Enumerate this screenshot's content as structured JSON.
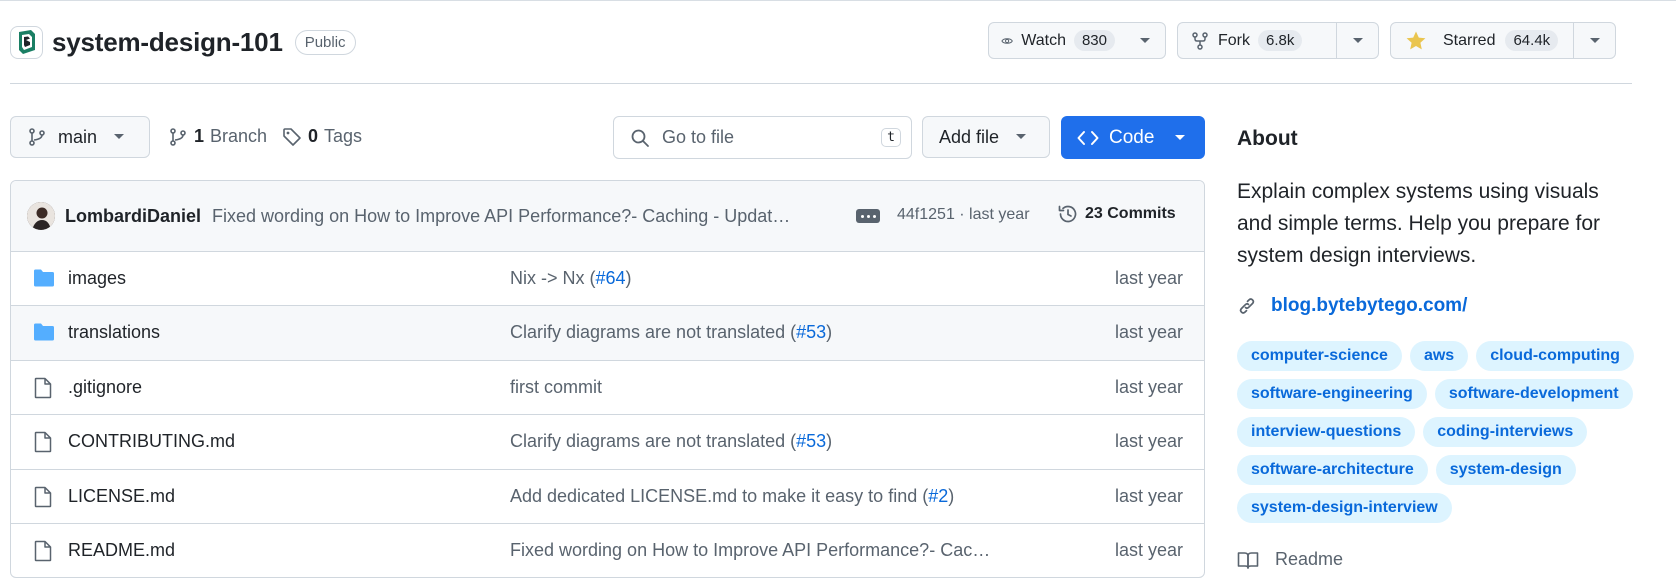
{
  "repo": {
    "name": "system-design-101",
    "visibility": "Public"
  },
  "header_actions": {
    "watch": {
      "label": "Watch",
      "count": "830"
    },
    "fork": {
      "label": "Fork",
      "count": "6.8k"
    },
    "star": {
      "label": "Starred",
      "count": "64.4k"
    }
  },
  "toolbar": {
    "branch": "main",
    "branches_count": "1",
    "branches_label": "Branch",
    "tags_count": "0",
    "tags_label": "Tags",
    "search_placeholder": "Go to file",
    "search_shortcut": "t",
    "add_file": "Add file",
    "code": "Code"
  },
  "latest_commit": {
    "author": "LombardiDaniel",
    "message": "Fixed wording on How to Improve API Performance?- Caching - Updat…",
    "hash_time": "44f1251 · last year",
    "commits_label": "23 Commits"
  },
  "files": [
    {
      "type": "folder",
      "name": "images",
      "msg": "Nix -> Nx (",
      "pr": "#64",
      "msg_end": ")",
      "date": "last year"
    },
    {
      "type": "folder",
      "name": "translations",
      "msg": "Clarify diagrams are not translated (",
      "pr": "#53",
      "msg_end": ")",
      "date": "last year"
    },
    {
      "type": "file",
      "name": ".gitignore",
      "msg": "first commit",
      "pr": "",
      "msg_end": "",
      "date": "last year"
    },
    {
      "type": "file",
      "name": "CONTRIBUTING.md",
      "msg": "Clarify diagrams are not translated (",
      "pr": "#53",
      "msg_end": ")",
      "date": "last year"
    },
    {
      "type": "file",
      "name": "LICENSE.md",
      "msg": "Add dedicated LICENSE.md to make it easy to find (",
      "pr": "#2",
      "msg_end": ")",
      "date": "last year"
    },
    {
      "type": "file",
      "name": "README.md",
      "msg": "Fixed wording on How to Improve API Performance?- Cac…",
      "pr": "",
      "msg_end": "",
      "date": "last year"
    }
  ],
  "about": {
    "title": "About",
    "description": "Explain complex systems using visuals and simple terms. Help you prepare for system design interviews.",
    "link": "blog.bytebytego.com/",
    "topics": [
      "computer-science",
      "aws",
      "cloud-computing",
      "software-engineering",
      "software-development",
      "interview-questions",
      "coding-interviews",
      "software-architecture",
      "system-design",
      "system-design-interview"
    ],
    "readme": "Readme"
  },
  "colors": {
    "accent": "#0969da",
    "code_button": "#1f6feb",
    "folder": "#54aeff",
    "star": "#eac54f",
    "topic_bg": "#ddf4ff"
  }
}
